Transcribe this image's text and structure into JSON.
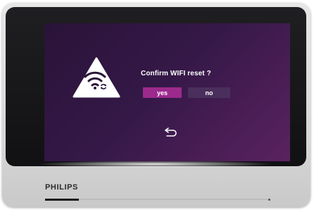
{
  "dialog": {
    "title": "Confirm WIFI reset ?",
    "yes_label": "yes",
    "no_label": "no",
    "icon": "wifi-reset-warning-icon"
  },
  "navigation": {
    "back_icon": "back-arrow-icon"
  },
  "device": {
    "brand": "PHILIPS",
    "progress_fraction": 0.15
  },
  "colors": {
    "screen_start": "#2a1338",
    "screen_end": "#5a2260",
    "yes_button": "#9c2a8c",
    "no_button": "#4a2f5c"
  }
}
